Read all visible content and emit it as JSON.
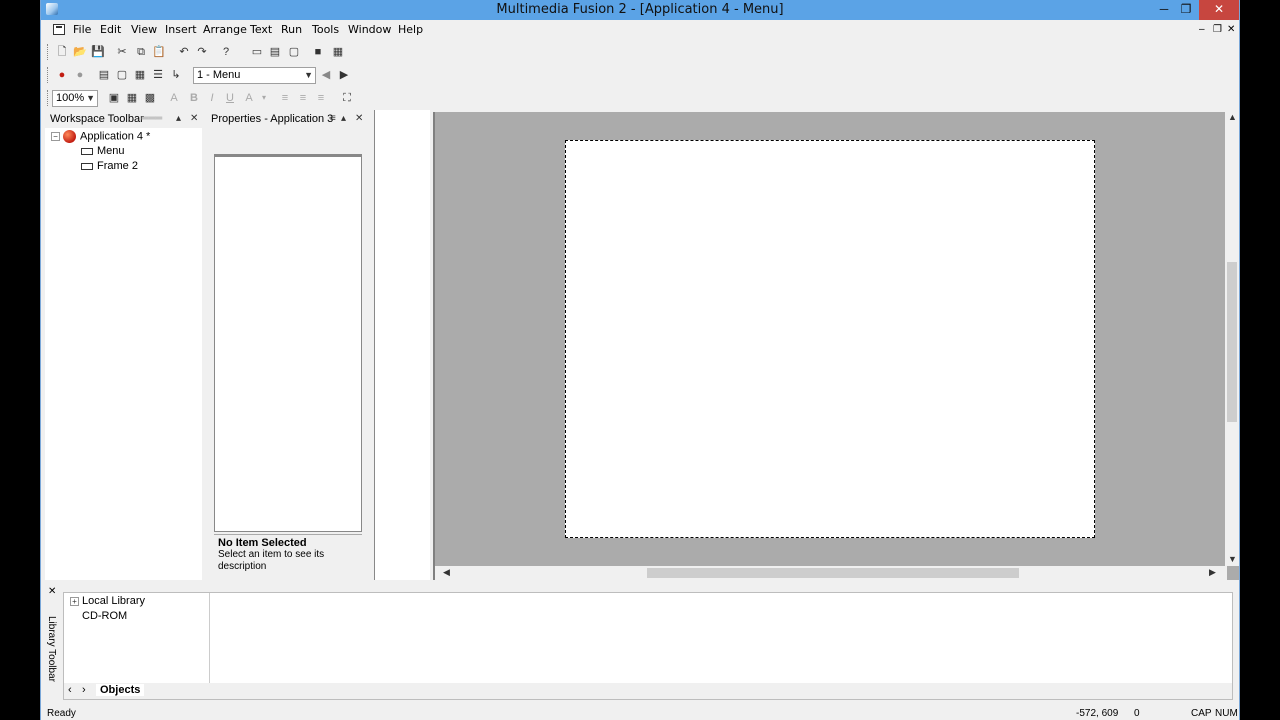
{
  "window": {
    "title": "Multimedia Fusion 2 - [Application 4 - Menu]",
    "minimize_glyph": "─",
    "restore_glyph": "❐",
    "close_glyph": "✕"
  },
  "menubar": {
    "items": [
      "File",
      "Edit",
      "View",
      "Insert",
      "Arrange",
      "Text",
      "Run",
      "Tools",
      "Window",
      "Help"
    ],
    "mdi_controls": [
      "–",
      "❐",
      "✕"
    ]
  },
  "toolbar": {
    "frame_select_value": "1 - Menu",
    "zoom_value": "100%",
    "bold_label": "B",
    "italic_label": "I",
    "underline_label": "U"
  },
  "workspace": {
    "header": "Workspace Toolbar",
    "tree": {
      "application": "Application 4 *",
      "frames": [
        "Menu",
        "Frame 2"
      ]
    }
  },
  "properties": {
    "header": "Properties - Application 3",
    "no_item_title": "No Item Selected",
    "no_item_desc": "Select an item to see its description"
  },
  "library": {
    "side_label": "Library Toolbar",
    "tree": [
      "Local Library",
      "CD-ROM"
    ],
    "tab": "Objects"
  },
  "statusbar": {
    "status": "Ready",
    "coords": "-572, 609",
    "value": "0",
    "cap": "CAP",
    "num": "NUM"
  },
  "colors": {
    "titlebar": "#5ba3e6",
    "close_button": "#c7463f",
    "editor_bg": "#ababab"
  }
}
